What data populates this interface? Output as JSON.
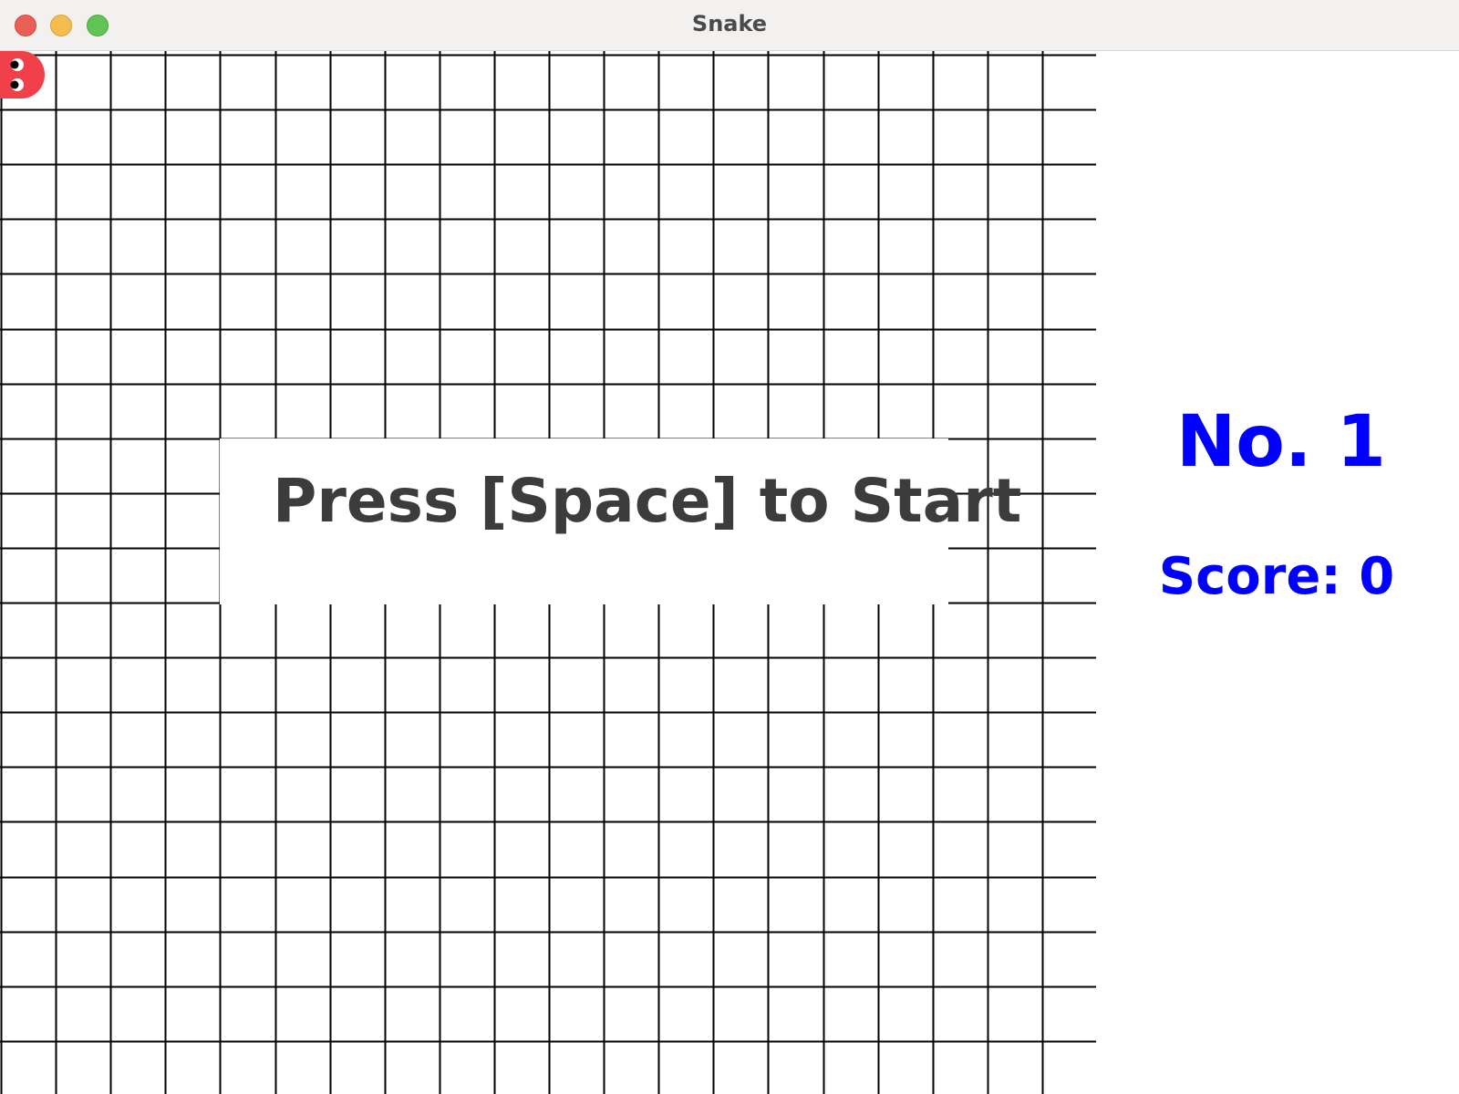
{
  "window": {
    "title": "Snake"
  },
  "board": {
    "columns": 20,
    "rows": 20,
    "grid_color": "#000000",
    "background": "#ffffff",
    "start_prompt": "Press [Space] to Start"
  },
  "snake": {
    "head_color": "#f0404a",
    "eye_color": "#000000",
    "head_cell": {
      "col": 2,
      "row": 19
    },
    "direction": "left"
  },
  "sidebar": {
    "rank_label": "No. 1",
    "score_label": "Score: 0",
    "text_color": "#0000ff"
  }
}
